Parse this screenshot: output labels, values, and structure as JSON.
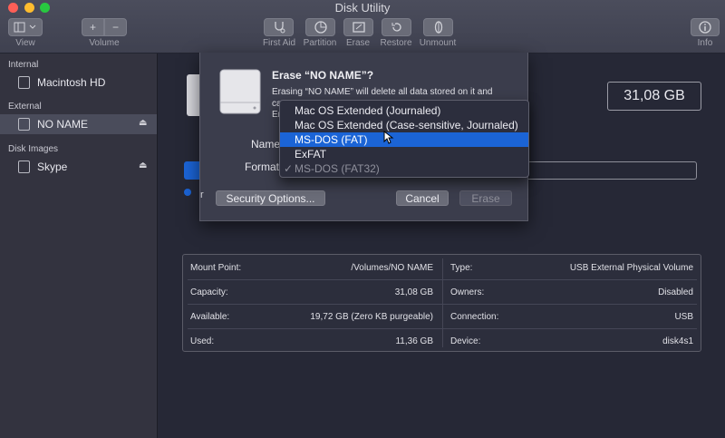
{
  "window": {
    "title": "Disk Utility"
  },
  "toolbar": {
    "view_label": "View",
    "volume_label": "Volume",
    "add_glyph": "+",
    "remove_glyph": "−",
    "items": [
      {
        "label": "First Aid",
        "icon": "stethoscope-icon"
      },
      {
        "label": "Partition",
        "icon": "pie-icon"
      },
      {
        "label": "Erase",
        "icon": "erase-icon"
      },
      {
        "label": "Restore",
        "icon": "restore-icon"
      },
      {
        "label": "Unmount",
        "icon": "unmount-icon"
      }
    ],
    "info_label": "Info"
  },
  "sidebar": {
    "sections": [
      {
        "title": "Internal",
        "items": [
          {
            "label": "Macintosh HD"
          }
        ]
      },
      {
        "title": "External",
        "items": [
          {
            "label": "NO NAME",
            "selected": true
          }
        ]
      },
      {
        "title": "Disk Images",
        "items": [
          {
            "label": "Skype"
          }
        ]
      }
    ],
    "eject_glyph": "⏏"
  },
  "main": {
    "size": "31,08 GB"
  },
  "info_table": {
    "left": [
      {
        "label": "Mount Point:",
        "value": "/Volumes/NO NAME"
      },
      {
        "label": "Capacity:",
        "value": "31,08 GB"
      },
      {
        "label": "Available:",
        "value": "19,72 GB (Zero KB purgeable)"
      },
      {
        "label": "Used:",
        "value": "11,36 GB"
      }
    ],
    "right": [
      {
        "label": "Type:",
        "value": "USB External Physical Volume"
      },
      {
        "label": "Owners:",
        "value": "Disabled"
      },
      {
        "label": "Connection:",
        "value": "USB"
      },
      {
        "label": "Device:",
        "value": "disk4s1"
      }
    ]
  },
  "dialog": {
    "title": "Erase “NO NAME”?",
    "desc_line1": "Erasing “NO NAME” will delete all data stored on it and",
    "desc_line2_fragment": "ca",
    "desc_line3_fragment": "Er",
    "name_label": "Name",
    "format_label": "Format",
    "radio_fragment": "r",
    "security_button": "Security Options...",
    "cancel_button": "Cancel",
    "erase_button": "Erase"
  },
  "format_menu": {
    "options": [
      {
        "label": "Mac OS Extended (Journaled)"
      },
      {
        "label": "Mac OS Extended (Case-sensitive, Journaled)"
      },
      {
        "label": "MS-DOS (FAT)",
        "highlighted": true
      },
      {
        "label": "ExFAT"
      },
      {
        "label": "MS-DOS (FAT32)",
        "checked": true
      }
    ],
    "check_glyph": "✓"
  },
  "colors": {
    "accent": "#1b64d6",
    "sidebar_selected": "#4a4c5b",
    "light_close": "#ff5f57",
    "light_min": "#febc2e",
    "light_zoom": "#28c840"
  }
}
